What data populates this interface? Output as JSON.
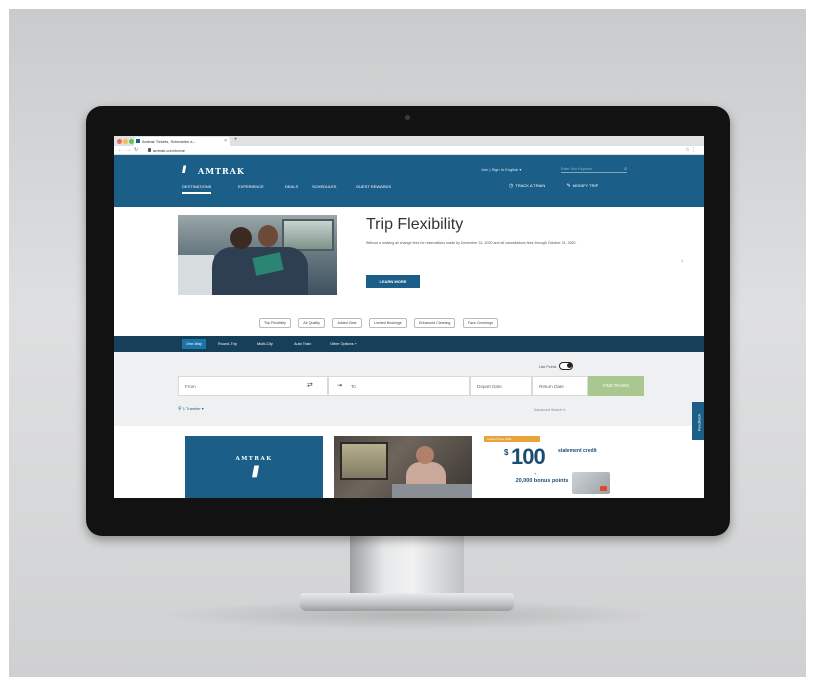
{
  "browser": {
    "tab_title": "Amtrak Tickets, Schedules a...",
    "url": "amtrak.com/home"
  },
  "header": {
    "logo_text": "AMTRAK",
    "util_links": "Join | Sign In   English ▾",
    "search_placeholder": "Enter Your Keyword",
    "nav": [
      "DESTINATIONS",
      "EXPERIENCE",
      "DEALS",
      "SCHEDULES",
      "GUEST REWARDS"
    ],
    "track_train": "TRACK A TRAIN",
    "modify_trip": "MODIFY TRIP"
  },
  "hero": {
    "title": "Trip Flexibility",
    "description": "Without a waiving all change fees for reservations made by December 31, 2020 and all cancellations fees through October 31, 2020.",
    "cta": "LEARN MORE"
  },
  "pills": [
    "Trip Flexibility",
    "Air Quality",
    "Added Gear",
    "Limited Bookings",
    "Enhanced Cleaning",
    "Face Coverings"
  ],
  "booking": {
    "tabs": [
      "One-Way",
      "Round-Trip",
      "Multi-City",
      "Auto Train",
      "Other Options +"
    ],
    "use_points_label": "Use Points",
    "from_placeholder": "From",
    "to_placeholder": "To",
    "depart_placeholder": "Depart Date",
    "return_placeholder": "Return Date",
    "find_button": "FIND TRAINS",
    "travelers": "1 Traveler",
    "advanced": "Advanced Search ▾"
  },
  "feedback": "Feedback",
  "cards": {
    "amtrak_wordmark": "AMTRAK",
    "offer_flag": "Limited-Time Offer",
    "offer_dollar": "$",
    "offer_amount": "100",
    "offer_statement": "statement credit",
    "offer_plus": "+",
    "offer_points": "20,000 bonus points"
  },
  "colors": {
    "brand_blue": "#1b5f89",
    "booking_bar": "#163f59",
    "find_button": "#a9c78e"
  }
}
